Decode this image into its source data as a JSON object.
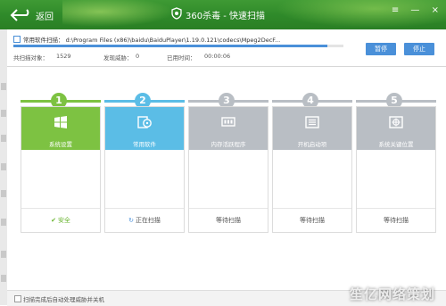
{
  "header": {
    "back_label": "返回",
    "title": "360杀毒 - 快速扫描",
    "window_controls": [
      "≡",
      "—",
      "×"
    ]
  },
  "scan": {
    "current_path": "常用软件扫描： d:\\Program Files (x86)\\baidu\\BaiduPlayer\\1.19.0.121\\codecs\\Mpeg2DecF...",
    "progress": 0.95,
    "scanned_label": "共扫描对象：",
    "scanned_value": "1529",
    "threats_label": "发现威胁：",
    "threats_value": "0",
    "elapsed_label": "已用时间：",
    "elapsed_value": "00:00:06",
    "pause_label": "暂停",
    "stop_label": "停止"
  },
  "steps": [
    {
      "number": "1",
      "label": "系统设置",
      "status": "安全",
      "state": "done",
      "icon": "windows-icon",
      "color": "#7dc242"
    },
    {
      "number": "2",
      "label": "常用软件",
      "status": "正在扫描",
      "state": "active",
      "icon": "software-disc-icon",
      "color": "#5bbde6"
    },
    {
      "number": "3",
      "label": "内存活跃程序",
      "status": "等待扫描",
      "state": "waiting",
      "icon": "memory-icon",
      "color": "#b9bec4"
    },
    {
      "number": "4",
      "label": "开机启动项",
      "status": "等待扫描",
      "state": "waiting",
      "icon": "startup-icon",
      "color": "#b9bec4"
    },
    {
      "number": "5",
      "label": "系统关键位置",
      "status": "等待扫描",
      "state": "waiting",
      "icon": "target-icon",
      "color": "#b9bec4"
    }
  ],
  "footer": {
    "auto_shutdown_label": "扫描完成后自动处理威胁并关机"
  },
  "watermark": "笙亿网络策划"
}
